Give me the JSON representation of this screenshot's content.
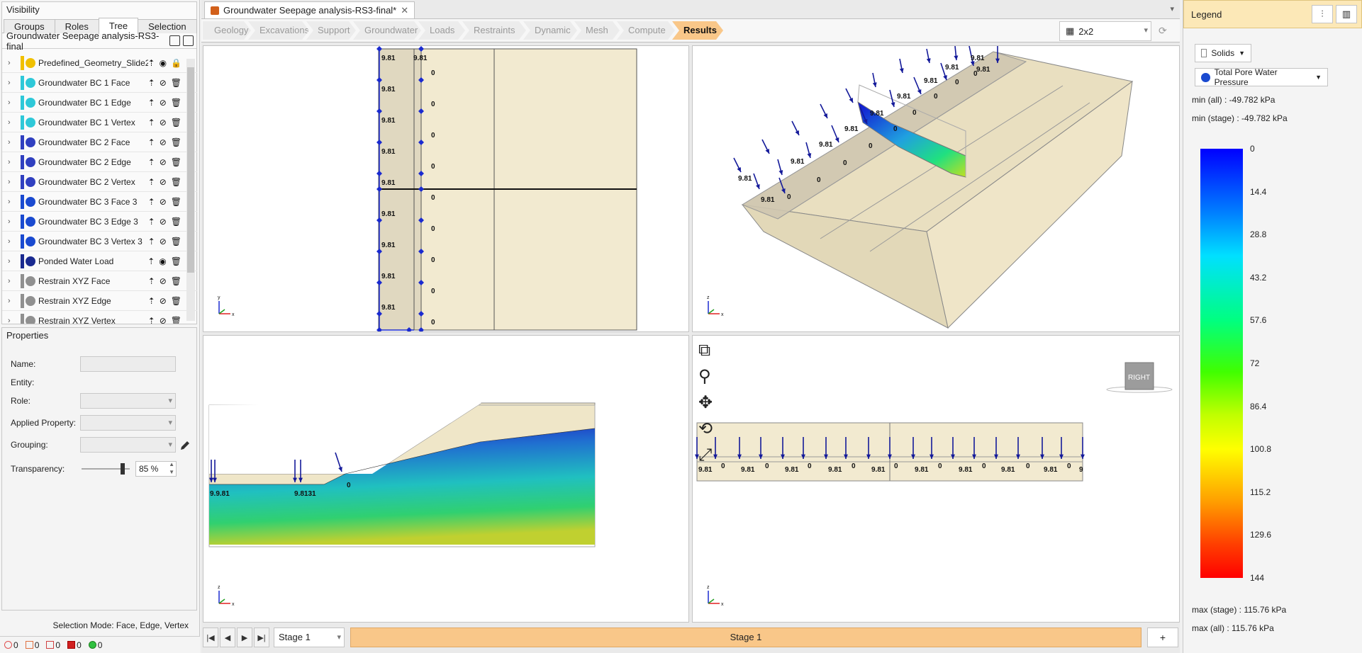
{
  "visibility": {
    "title": "Visibility",
    "tabs": [
      "Groups",
      "Roles",
      "Tree",
      "Selection"
    ],
    "active_tab": "Tree",
    "tree_title": "Groundwater Seepage analysis-RS3-final",
    "items": [
      {
        "label": "Predefined_Geometry_Slide2",
        "color": "#f0c000",
        "icon": "terrain-icon"
      },
      {
        "label": "Groundwater BC 1 Face",
        "color": "#2ec8d8",
        "icon": "bc-icon"
      },
      {
        "label": "Groundwater BC 1 Edge",
        "color": "#2ec8d8",
        "icon": "bc-icon"
      },
      {
        "label": "Groundwater BC 1 Vertex",
        "color": "#2ec8d8",
        "icon": "bc-icon"
      },
      {
        "label": "Groundwater BC 2 Face",
        "color": "#3040c0",
        "icon": "bc-icon"
      },
      {
        "label": "Groundwater BC 2 Edge",
        "color": "#3040c0",
        "icon": "bc-icon"
      },
      {
        "label": "Groundwater BC 2 Vertex",
        "color": "#3040c0",
        "icon": "bc-icon"
      },
      {
        "label": "Groundwater BC 3 Face 3",
        "color": "#1a4ad0",
        "icon": "bc-icon"
      },
      {
        "label": "Groundwater BC 3 Edge 3",
        "color": "#1a4ad0",
        "icon": "bc-icon"
      },
      {
        "label": "Groundwater BC 3 Vertex 3",
        "color": "#1a4ad0",
        "icon": "bc-icon"
      },
      {
        "label": "Ponded Water Load",
        "color": "#1a2a90",
        "icon": "load-icon"
      },
      {
        "label": "Restrain XYZ Face",
        "color": "#909090",
        "icon": "restrain-icon"
      },
      {
        "label": "Restrain XYZ Edge",
        "color": "#909090",
        "icon": "restrain-icon"
      },
      {
        "label": "Restrain XYZ Vertex",
        "color": "#909090",
        "icon": "restrain-icon"
      }
    ]
  },
  "properties": {
    "title": "Properties",
    "name_label": "Name:",
    "entity_label": "Entity:",
    "role_label": "Role:",
    "applied_property_label": "Applied Property:",
    "grouping_label": "Grouping:",
    "transparency_label": "Transparency:",
    "transparency_value": "85 %",
    "transparency_fraction": 0.85
  },
  "selection_mode": "Selection Mode: Face, Edge, Vertex",
  "status_counts": [
    "0",
    "0",
    "0",
    "0",
    "0"
  ],
  "document_tab": "Groundwater Seepage analysis-RS3-final*",
  "workflow_steps": [
    "Geology",
    "Excavations",
    "Support",
    "Groundwater",
    "Loads",
    "Restraints",
    "Dynamic",
    "Mesh",
    "Compute",
    "Results"
  ],
  "active_step": "Results",
  "layout_value": "2x2",
  "view_labels": {
    "head": "9.81",
    "zero": "0",
    "truncated": "9",
    "merged1": "9.9.81",
    "merged2": "9.8131",
    "orient_cube": "RIGHT",
    "axis_x": "x",
    "axis_y": "y",
    "axis_z": "z"
  },
  "stage_select": "Stage 1",
  "stage_band": "Stage 1",
  "plus_label": "+",
  "legend": {
    "title": "Legend",
    "solids_label": "Solids",
    "result_type": "Total Pore Water Pressure",
    "min_all": "min (all) :      -49.782 kPa",
    "min_stage": "min (stage) :  -49.782 kPa",
    "max_stage": "max (stage) :  115.76 kPa",
    "max_all": "max (all) :      115.76 kPa",
    "ticks": [
      "0",
      "14.4",
      "28.8",
      "43.2",
      "57.6",
      "72",
      "86.4",
      "100.8",
      "115.2",
      "129.6",
      "144"
    ]
  }
}
